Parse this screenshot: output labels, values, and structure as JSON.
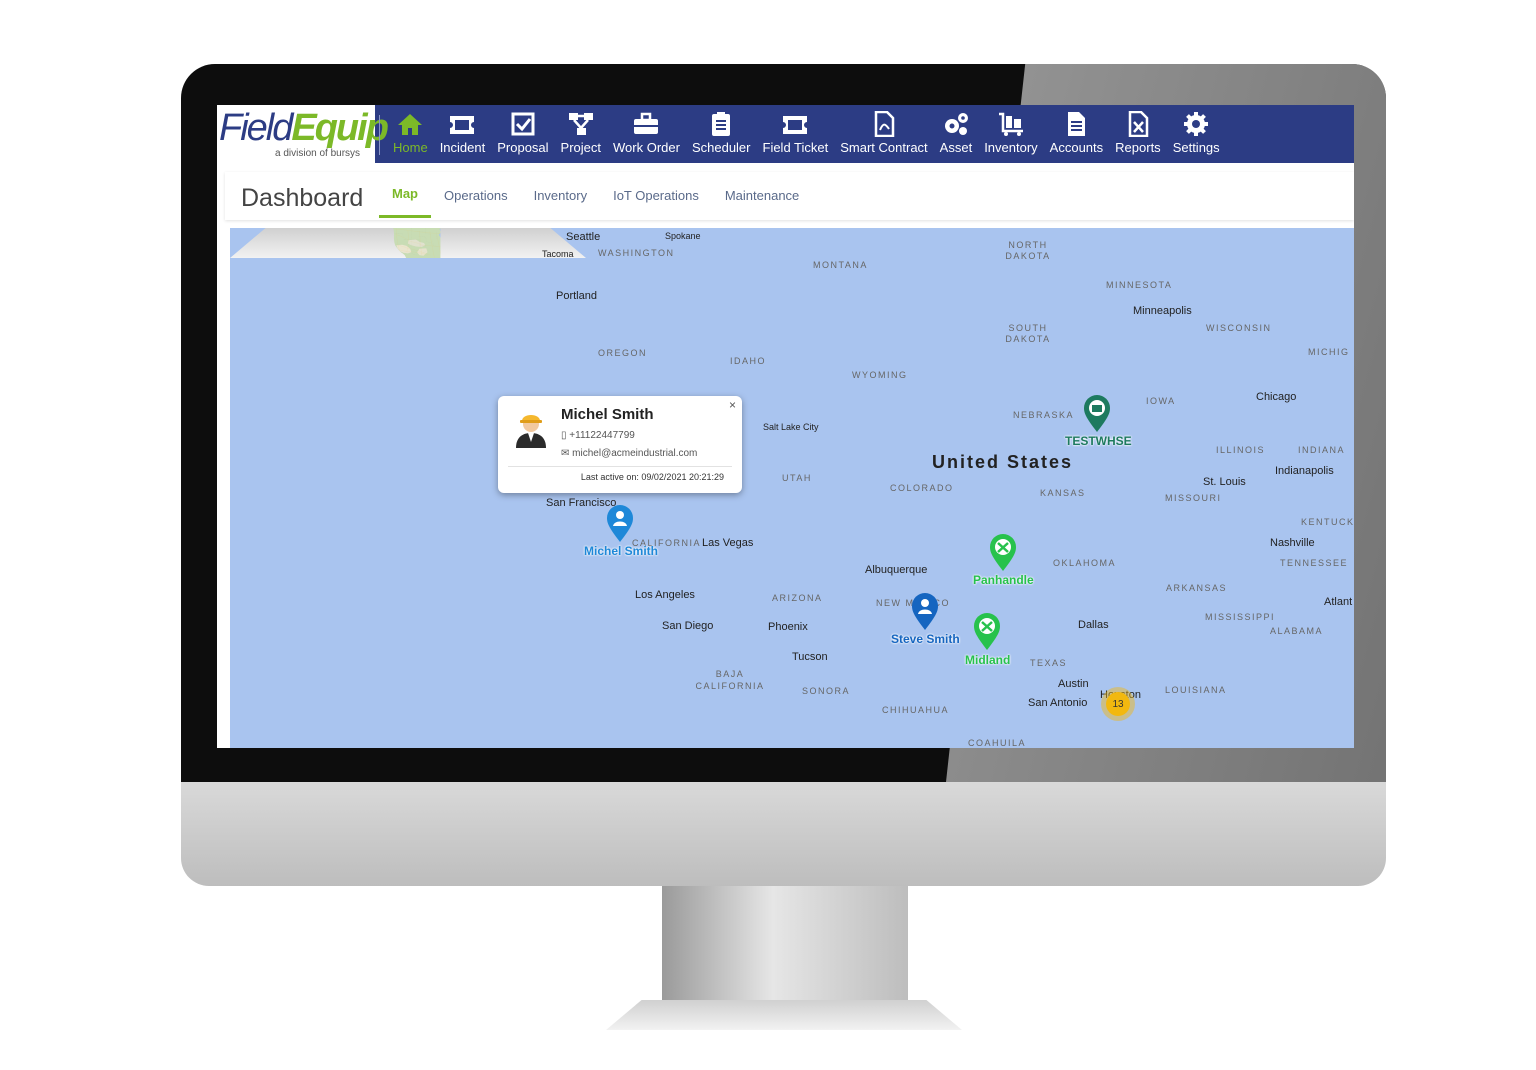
{
  "app": {
    "logo_field": "Field",
    "logo_equip": "Equip",
    "logo_sub": "a division of bursys"
  },
  "nav": [
    {
      "label": "Home",
      "icon": "home-icon",
      "active": true
    },
    {
      "label": "Incident",
      "icon": "ticket-icon"
    },
    {
      "label": "Proposal",
      "icon": "checkbox-icon"
    },
    {
      "label": "Project",
      "icon": "sitemap-icon"
    },
    {
      "label": "Work Order",
      "icon": "briefcase-icon"
    },
    {
      "label": "Scheduler",
      "icon": "clipboard-icon"
    },
    {
      "label": "Field Ticket",
      "icon": "ticket-icon"
    },
    {
      "label": "Smart Contract",
      "icon": "pdf-file-icon"
    },
    {
      "label": "Asset",
      "icon": "gears-icon"
    },
    {
      "label": "Inventory",
      "icon": "cart-icon"
    },
    {
      "label": "Accounts",
      "icon": "document-icon"
    },
    {
      "label": "Reports",
      "icon": "excel-file-icon"
    },
    {
      "label": "Settings",
      "icon": "gear-icon"
    }
  ],
  "dashboard": {
    "title": "Dashboard",
    "tabs": [
      "Map",
      "Operations",
      "Inventory",
      "IoT Operations",
      "Maintenance"
    ],
    "active_tab": "Map"
  },
  "map": {
    "country_label": "United States",
    "cities": [
      "Seattle",
      "Spokane",
      "Tacoma",
      "Portland",
      "Minneapolis",
      "Chicago",
      "Salt Lake City",
      "Indianapolis",
      "St. Louis",
      "San Francisco",
      "Las Vegas",
      "Nashville",
      "Albuquerque",
      "Los Angeles",
      "San Diego",
      "Phoenix",
      "Dallas",
      "Tucson",
      "Atlant",
      "Austin",
      "San Antonio",
      "Houston"
    ],
    "states": [
      "WASHINGTON",
      "MONTANA",
      "NORTH DAKOTA",
      "MINNESOTA",
      "OREGON",
      "IDAHO",
      "SOUTH DAKOTA",
      "WISCONSIN",
      "MICHIG",
      "WYOMING",
      "NEBRASKA",
      "IOWA",
      "UTAH",
      "COLORADO",
      "KANSAS",
      "ILLINOIS",
      "INDIANA",
      "MISSOURI",
      "KENTUCK",
      "CALIFORNIA",
      "OKLAHOMA",
      "TENNESSEE",
      "ARIZONA",
      "NEW MEXICO",
      "ARKANSAS",
      "MISSISSIPPI",
      "ALABAMA",
      "TEXAS",
      "LOUISIANA",
      "BAJA CALIFORNIA",
      "SONORA",
      "CHIHUAHUA",
      "COAHUILA"
    ],
    "markers": [
      {
        "label": "Michel Smith",
        "type": "person",
        "color": "#1e88d8"
      },
      {
        "label": "Steve Smith",
        "type": "person",
        "color": "#1565c0"
      },
      {
        "label": "Panhandle",
        "type": "site",
        "color": "#27c24c"
      },
      {
        "label": "Midland",
        "type": "site",
        "color": "#27c24c"
      },
      {
        "label": "TESTWHSE",
        "type": "warehouse",
        "color": "#1d7a5f"
      }
    ],
    "cluster_count": "13"
  },
  "popup": {
    "name": "Michel Smith",
    "phone": "+11122447799",
    "email": "michel@acmeindustrial.com",
    "last_active": "Last active on: 09/02/2021 20:21:29",
    "close": "×"
  },
  "colors": {
    "nav_bg": "#2c3c84",
    "accent": "#7cb928",
    "map_water": "#a9c4ef",
    "map_land": "#c8dcb4"
  }
}
